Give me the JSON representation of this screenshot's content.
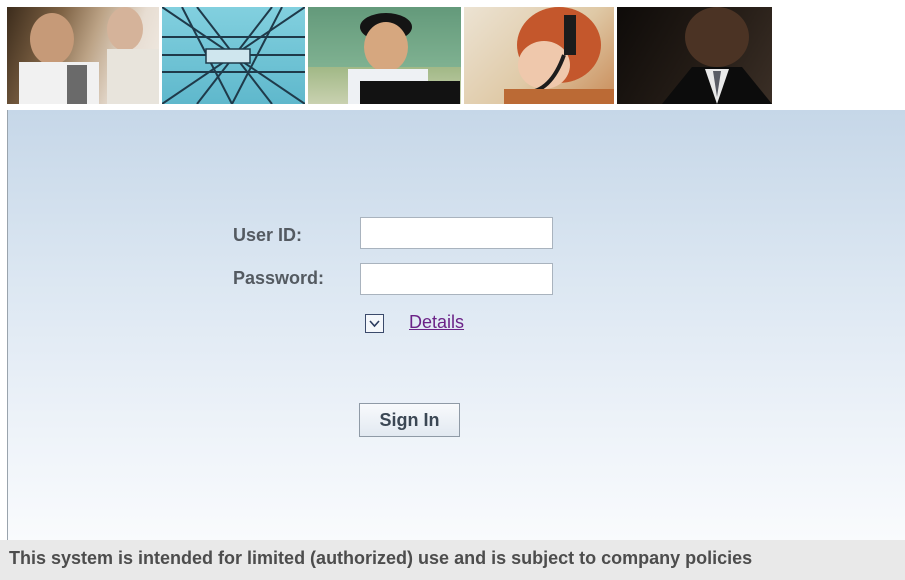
{
  "banner": {
    "tiles": [
      {
        "name": "business-meeting"
      },
      {
        "name": "transmission-tower"
      },
      {
        "name": "man-at-computer"
      },
      {
        "name": "headset-operator"
      },
      {
        "name": "businessman"
      }
    ]
  },
  "login": {
    "user_id_label": "User ID:",
    "user_id_value": "",
    "password_label": "Password:",
    "password_value": "",
    "details_icon": "chevron-down-icon",
    "details_label": "Details",
    "sign_in_label": "Sign In"
  },
  "footer": {
    "notice": "This system is intended for limited (authorized) use and is subject to company policies"
  },
  "colors": {
    "panel_top": "#c6d7e8",
    "panel_bottom": "#f9fbfd",
    "label_text": "#545a61",
    "link_visited": "#6b2287",
    "footer_bg": "#e9e9e9"
  }
}
